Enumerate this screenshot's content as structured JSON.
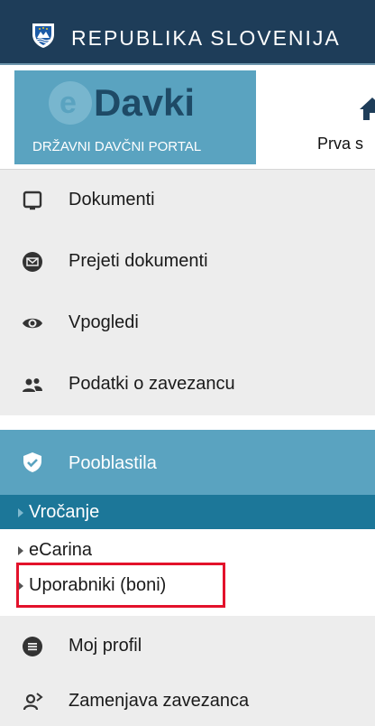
{
  "header": {
    "title": "REPUBLIKA SLOVENIJA",
    "logo_brand": "Davki",
    "logo_subtitle": "DRŽAVNI DAVČNI PORTAL",
    "home_label": "Prva s"
  },
  "menu": {
    "items": [
      {
        "label": "Dokumenti",
        "icon": "document-icon"
      },
      {
        "label": "Prejeti dokumenti",
        "icon": "envelope-icon"
      },
      {
        "label": "Vpogledi",
        "icon": "eye-icon"
      },
      {
        "label": "Podatki o zavezancu",
        "icon": "users-icon"
      },
      {
        "label": "Pooblastila",
        "icon": "shield-check-icon"
      },
      {
        "label": "Moj profil",
        "icon": "list-icon"
      },
      {
        "label": "Zamenjava zavezanca",
        "icon": "switch-user-icon"
      }
    ],
    "subitems": [
      {
        "label": "Vročanje",
        "state": "selected"
      },
      {
        "label": "eCarina",
        "state": "normal"
      },
      {
        "label": "Uporabniki (boni)",
        "state": "highlighted"
      }
    ]
  },
  "colors": {
    "topbar": "#1e3d59",
    "accent": "#5aa3c0",
    "selected": "#1c7799",
    "highlight_border": "#e3122b"
  }
}
